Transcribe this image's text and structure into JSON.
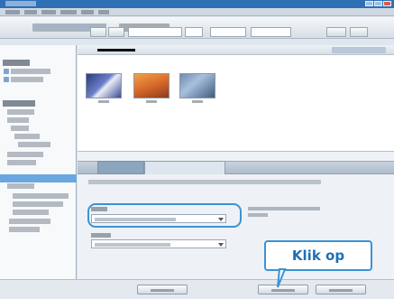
{
  "callout": {
    "text": "Klik op"
  },
  "colors": {
    "accent": "#3b93d3",
    "titlebar": "#2f6fb4",
    "callout_text": "#1f6fb2"
  },
  "icons": {
    "window_controls": [
      "minimize-icon",
      "maximize-icon",
      "close-icon"
    ]
  }
}
